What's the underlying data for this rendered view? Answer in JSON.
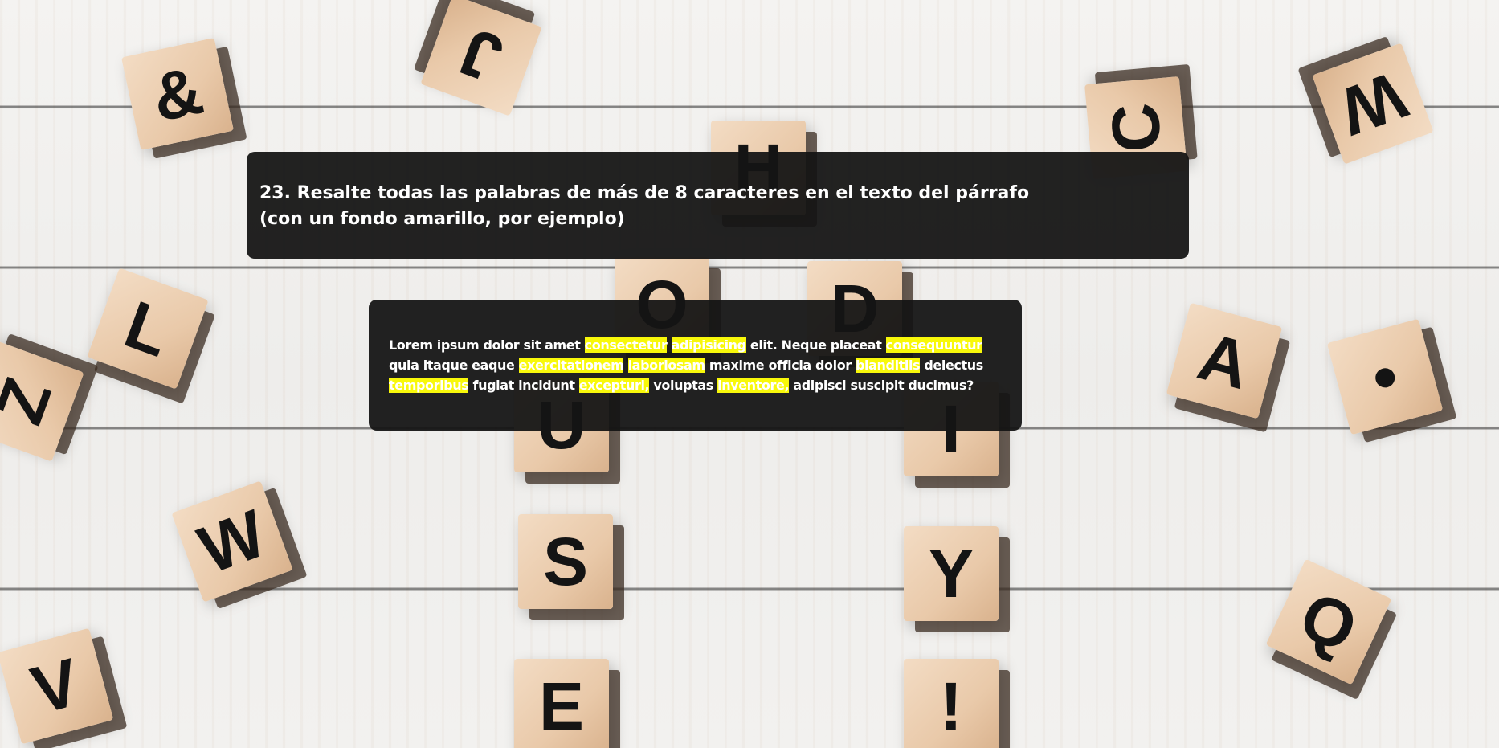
{
  "background": {
    "blocks": [
      "&",
      "J",
      "H",
      "C",
      "W",
      "L",
      "O",
      "D",
      "Z",
      "A",
      "•",
      "U",
      "I",
      "W",
      "S",
      "Y",
      "V",
      "Q",
      "E",
      "!"
    ]
  },
  "exercise": {
    "title_line1": "23. Resalte todas las palabras de más de 8 caracteres en el texto del párrafo",
    "title_line2": "(con un fondo amarillo, por ejemplo)"
  },
  "paragraph": {
    "tokens": [
      {
        "text": "Lorem",
        "highlight": false
      },
      {
        "text": "ipsum",
        "highlight": false
      },
      {
        "text": "dolor",
        "highlight": false
      },
      {
        "text": "sit",
        "highlight": false
      },
      {
        "text": "amet",
        "highlight": false
      },
      {
        "text": "consectetur",
        "highlight": true
      },
      {
        "text": "adipisicing",
        "highlight": true
      },
      {
        "text": "elit.",
        "highlight": false
      },
      {
        "text": "Neque",
        "highlight": false
      },
      {
        "text": "placeat",
        "highlight": false
      },
      {
        "text": "consequuntur",
        "highlight": true
      },
      {
        "text": "quia",
        "highlight": false
      },
      {
        "text": "itaque",
        "highlight": false
      },
      {
        "text": "eaque",
        "highlight": false
      },
      {
        "text": "exercitationem",
        "highlight": true
      },
      {
        "text": "laboriosam",
        "highlight": true
      },
      {
        "text": "maxime",
        "highlight": false
      },
      {
        "text": "officia",
        "highlight": false
      },
      {
        "text": "dolor",
        "highlight": false
      },
      {
        "text": "blanditiis",
        "highlight": true
      },
      {
        "text": "delectus",
        "highlight": false
      },
      {
        "text": "temporibus",
        "highlight": true
      },
      {
        "text": "fugiat",
        "highlight": false
      },
      {
        "text": "incidunt",
        "highlight": false
      },
      {
        "text": "excepturi,",
        "highlight": true
      },
      {
        "text": "voluptas",
        "highlight": false
      },
      {
        "text": "inventore,",
        "highlight": true
      },
      {
        "text": "adipisci",
        "highlight": false
      },
      {
        "text": "suscipit",
        "highlight": false
      },
      {
        "text": "ducimus?",
        "highlight": false
      }
    ],
    "highlight_color": "#f8f80a"
  },
  "colors": {
    "card_background": "#141414",
    "text": "#ffffff",
    "highlight": "#f8f80a"
  }
}
